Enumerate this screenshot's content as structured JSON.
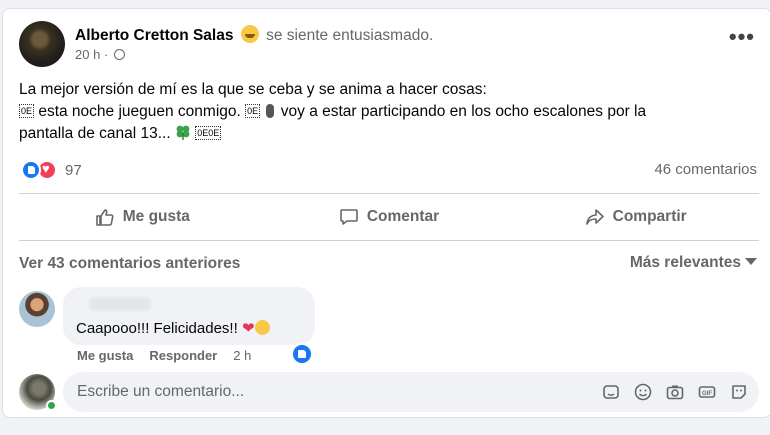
{
  "post": {
    "author": "Alberto Cretton Salas",
    "feeling": "se siente entusiasmado.",
    "time": "20 h",
    "more_label": "•••",
    "text_line1": "La mejor versión de mí es la que se ceba y se anima a hacer cosas:",
    "box1": "0E\n6E",
    "text_line2a": " esta noche jueguen conmigo. ",
    "text_line2b": " voy a estar participando en los ocho escalones por la",
    "text_line3": "pantalla de canal 13... ",
    "reactions_count": "97",
    "comments_count": "46 comentarios"
  },
  "actions": {
    "like": "Me gusta",
    "comment": "Comentar",
    "share": "Compartir"
  },
  "comments_section": {
    "previous": "Ver 43 comentarios anteriores",
    "sort": "Más relevantes"
  },
  "comment": {
    "text": "Caapooo!!! Felicidades!! ",
    "like": "Me gusta",
    "reply": "Responder",
    "time": "2 h"
  },
  "composer": {
    "placeholder": "Escribe un comentario..."
  },
  "icons": [
    "globe-icon",
    "more-icon",
    "like-icon",
    "comment-icon",
    "share-icon",
    "sticker-icon",
    "emoji-icon",
    "camera-icon",
    "gif-icon",
    "avatar-sticker-icon"
  ],
  "colors": {
    "brand": "#1877f2",
    "love": "#f33e58",
    "online": "#31a24c"
  }
}
